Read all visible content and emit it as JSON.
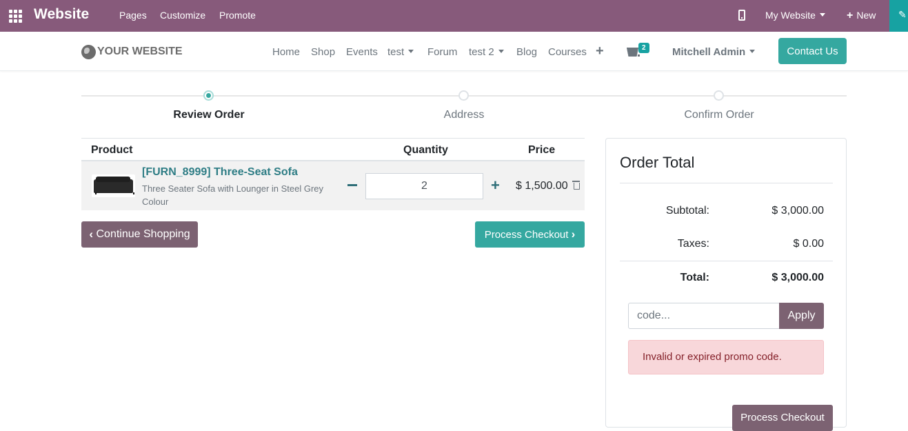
{
  "topbar": {
    "app_title": "Website",
    "menu": [
      "Pages",
      "Customize",
      "Promote"
    ],
    "my_website": "My Website",
    "new_label": "New",
    "plus_glyph": "+"
  },
  "header": {
    "logo_text": "YOUR WEBSITE",
    "nav": [
      "Home",
      "Shop",
      "Events",
      "test",
      "Forum",
      "test 2",
      "Blog",
      "Courses"
    ],
    "nav_plus": "+",
    "cart_count": "2",
    "user_name": "Mitchell Admin",
    "contact_label": "Contact Us"
  },
  "wizard": {
    "steps": [
      {
        "label": "Review Order",
        "active": true
      },
      {
        "label": "Address",
        "active": false
      },
      {
        "label": "Confirm Order",
        "active": false
      }
    ]
  },
  "cart": {
    "columns": {
      "product": "Product",
      "quantity": "Quantity",
      "price": "Price"
    },
    "items": [
      {
        "name": "[FURN_8999] Three-Seat Sofa",
        "description": "Three Seater Sofa with Lounger in Steel Grey Colour",
        "quantity": "2",
        "price": "$ 1,500.00"
      }
    ],
    "continue_label": "Continue Shopping",
    "checkout_label": "Process Checkout"
  },
  "order_total": {
    "title": "Order Total",
    "subtotal_label": "Subtotal:",
    "subtotal_value": "$ 3,000.00",
    "taxes_label": "Taxes:",
    "taxes_value": "$ 0.00",
    "total_label": "Total:",
    "total_value": "$ 3,000.00",
    "promo_placeholder": "code...",
    "apply_label": "Apply",
    "alert_message": "Invalid or expired promo code.",
    "checkout_label": "Process Checkout"
  },
  "colors": {
    "topbar": "#875a7b",
    "accent": "#35a8a0",
    "secondary_button": "#7c6272",
    "alert_bg": "#f8d7da"
  }
}
